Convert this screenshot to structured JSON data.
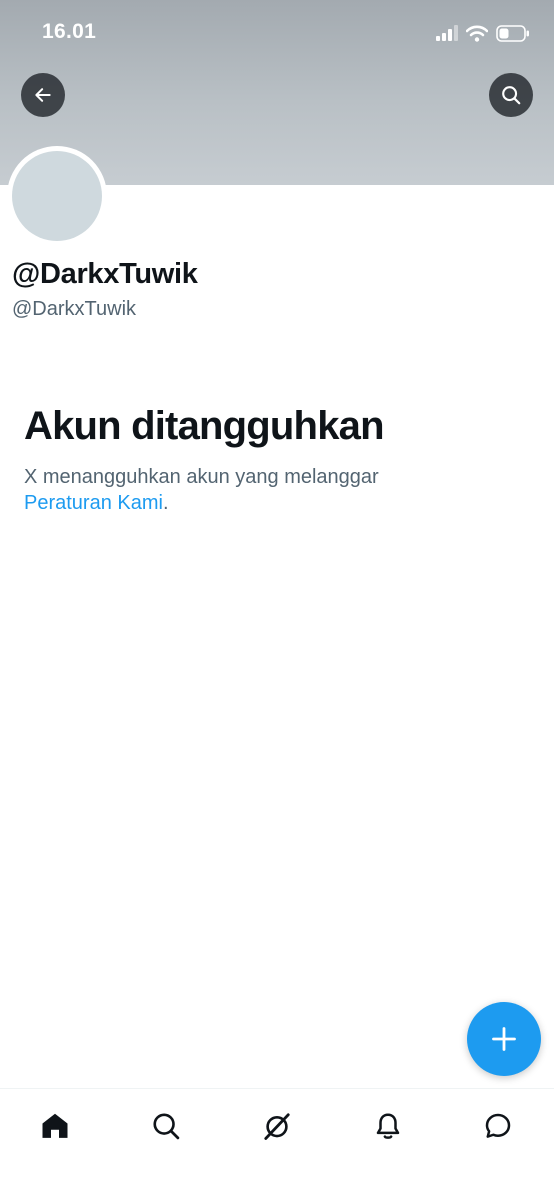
{
  "status_bar": {
    "time": "16.01"
  },
  "profile": {
    "display_name": "@DarkxTuwik",
    "handle": "@DarkxTuwik"
  },
  "suspension": {
    "title": "Akun ditangguhkan",
    "message": "X menangguhkan akun yang melanggar",
    "link_text": "Peraturan Kami",
    "trailing": "."
  },
  "icons": {
    "back": "arrow-left-icon",
    "search": "search-icon",
    "compose": "plus-icon",
    "nav": [
      "home-icon",
      "search-icon",
      "grok-icon",
      "bell-icon",
      "message-icon"
    ]
  },
  "colors": {
    "accent": "#1d9bf0",
    "text_primary": "#0f1419",
    "text_secondary": "#536471",
    "avatar_placeholder": "#cfd9de"
  }
}
